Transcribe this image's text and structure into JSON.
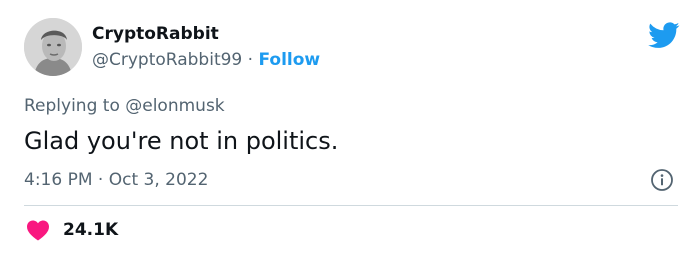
{
  "author": {
    "display_name": "CryptoRabbit",
    "handle": "@CryptoRabbit99",
    "separator": "·",
    "follow_label": "Follow"
  },
  "reply": {
    "prefix": "Replying to",
    "mention": "@elonmusk"
  },
  "tweet": {
    "text": "Glad you're not in politics.",
    "time": "4:16 PM",
    "separator": "·",
    "date": "Oct 3, 2022"
  },
  "engagement": {
    "likes": "24.1K"
  },
  "icons": {
    "brand": "twitter-bird-icon",
    "info": "info-icon",
    "like": "heart-icon"
  },
  "colors": {
    "brand_blue": "#1d9bf0",
    "text_primary": "#0f1419",
    "text_secondary": "#536471",
    "like_pink": "#f91880",
    "divider": "#cfd9de"
  }
}
